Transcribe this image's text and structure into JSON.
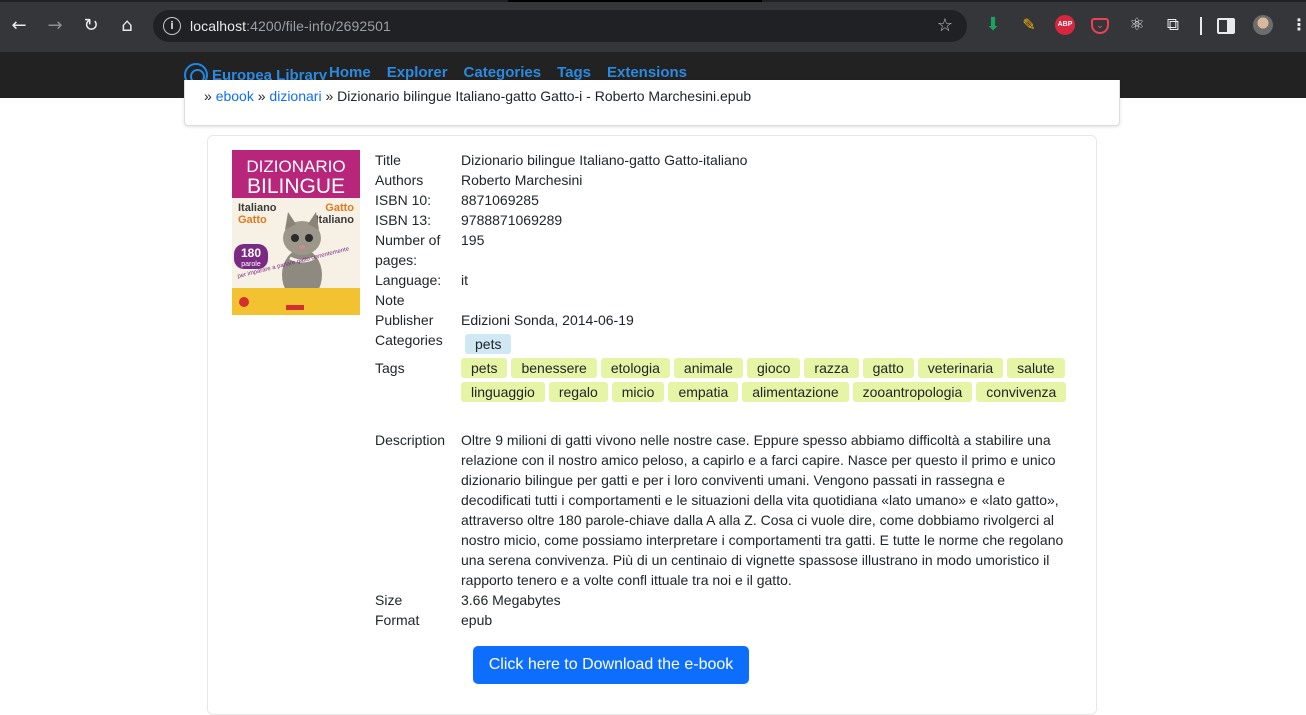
{
  "browser": {
    "url_host": "localhost",
    "url_path": ":4200/file-info/2692501"
  },
  "icons": {
    "back": "arrow-left-icon",
    "forward": "arrow-right-icon",
    "reload": "reload-icon",
    "home": "home-icon",
    "site_info": "info-icon",
    "bookmark": "star-icon",
    "download_ext": "download-icon",
    "pen_ext": "highlighter-icon",
    "adblock_ext": "adblock-icon",
    "pocket_ext": "pocket-icon",
    "react_ext": "react-icon",
    "extensions": "puzzle-icon",
    "side_panel": "side-panel-icon",
    "profile": "avatar-icon",
    "menu": "kebab-menu-icon",
    "brand_logo": "aperture-logo-icon"
  },
  "abp_label": "ABP",
  "app": {
    "brand": "Europea Library",
    "nav": [
      "Home",
      "Explorer",
      "Categories",
      "Tags",
      "Extensions"
    ]
  },
  "breadcrumb": {
    "sep1": "» ",
    "link1": "ebook",
    "sep2": " » ",
    "link2": "dizionari",
    "sep3": " » ",
    "current": "Dizionario bilingue Italiano-gatto Gatto-i - Roberto Marchesini.epub"
  },
  "cover": {
    "line1": "DIZIONARIO",
    "line2": "BILINGUE",
    "left_top": "Italiano",
    "left_bottom": "Gatto",
    "right_top": "Gatto",
    "right_bottom": "Italiano",
    "badge_num": "180",
    "badge_word": "parole",
    "tagline": "per imparare a parlare gatto correntemente"
  },
  "book": {
    "labels": {
      "title": "Title",
      "authors": "Authors",
      "isbn10": "ISBN 10:",
      "isbn13": "ISBN 13:",
      "pages": "Number of pages:",
      "language": "Language:",
      "note": "Note",
      "publisher": "Publisher",
      "categories": "Categories",
      "tags": "Tags",
      "description": "Description",
      "size": "Size",
      "format": "Format"
    },
    "title": "Dizionario bilingue Italiano-gatto Gatto-italiano",
    "authors": "Roberto Marchesini",
    "isbn10": "8871069285",
    "isbn13": "9788871069289",
    "pages": "195",
    "language": "it",
    "note": "",
    "publisher": "Edizioni Sonda, 2014-06-19",
    "categories": [
      "pets"
    ],
    "tags": [
      "pets",
      "benessere",
      "etologia",
      "animale",
      "gioco",
      "razza",
      "gatto",
      "veterinaria",
      "salute",
      "linguaggio",
      "regalo",
      "micio",
      "empatia",
      "alimentazione",
      "zooantropologia",
      "convivenza"
    ],
    "description": "Oltre 9 milioni di gatti vivono nelle nostre case. Eppure spesso abbiamo difficoltà a stabilire una relazione con il nostro amico peloso, a capirlo e a farci capire. Nasce per questo il primo e unico dizionario bilingue per gatti e per i loro conviventi umani. Vengono passati in rassegna e decodificati tutti i comportamenti e le situazioni della vita quotidiana «lato umano» e «lato gatto», attraverso oltre 180 parole-chiave dalla A alla Z. Cosa ci vuole dire, come dobbiamo rivolgerci al nostro micio, come possiamo interpretare i comportamenti tra gatti. E tutte le norme che regolano una serena convivenza. Più di un centinaio di vignette spassose illustrano in modo umoristico il rapporto tenero e a volte confl ittuale tra noi e il gatto.",
    "size": "3.66 Megabytes",
    "format": "epub"
  },
  "download_label": "Click here to Download the e-book",
  "colors": {
    "accent": "#0d6efd",
    "brand": "#2b8ae0",
    "tag_bg": "#e6f4a6",
    "category_bg": "#cfe8f3",
    "navbar_bg": "#222222"
  }
}
